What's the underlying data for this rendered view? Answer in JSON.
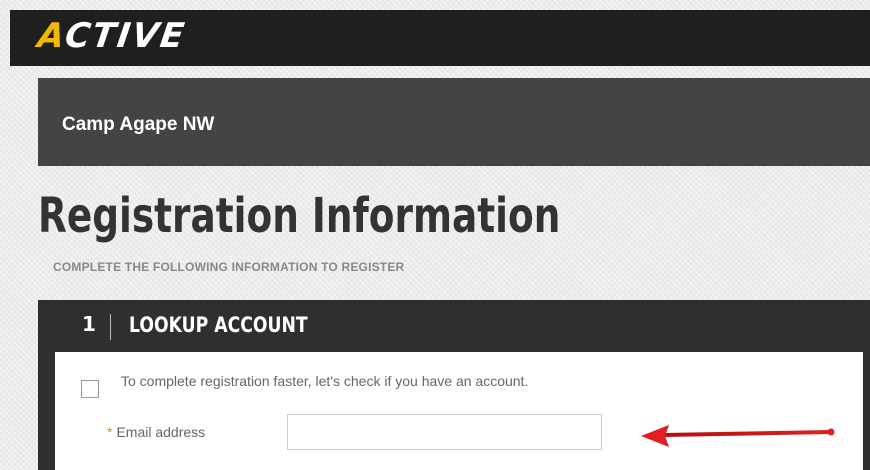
{
  "brand": {
    "logo_lead": "A",
    "logo_rest": "CTIVE"
  },
  "organization": {
    "name": "Camp Agape NW"
  },
  "page": {
    "title": "Registration Information",
    "subtitle": "COMPLETE THE FOLLOWING INFORMATION TO REGISTER"
  },
  "section": {
    "number": "1",
    "title": "LOOKUP ACCOUNT",
    "checkbox_label": "To complete registration faster, let's check if you have an account.",
    "email": {
      "required_mark": "*",
      "label": "Email address",
      "value": "",
      "placeholder": ""
    }
  },
  "annotation": {
    "arrow_color": "#e02020"
  },
  "colors": {
    "top_bar": "#1f1f1f",
    "org_bar": "#444444",
    "section_header": "#2f2f2f",
    "logo_accent": "#f2b700"
  }
}
